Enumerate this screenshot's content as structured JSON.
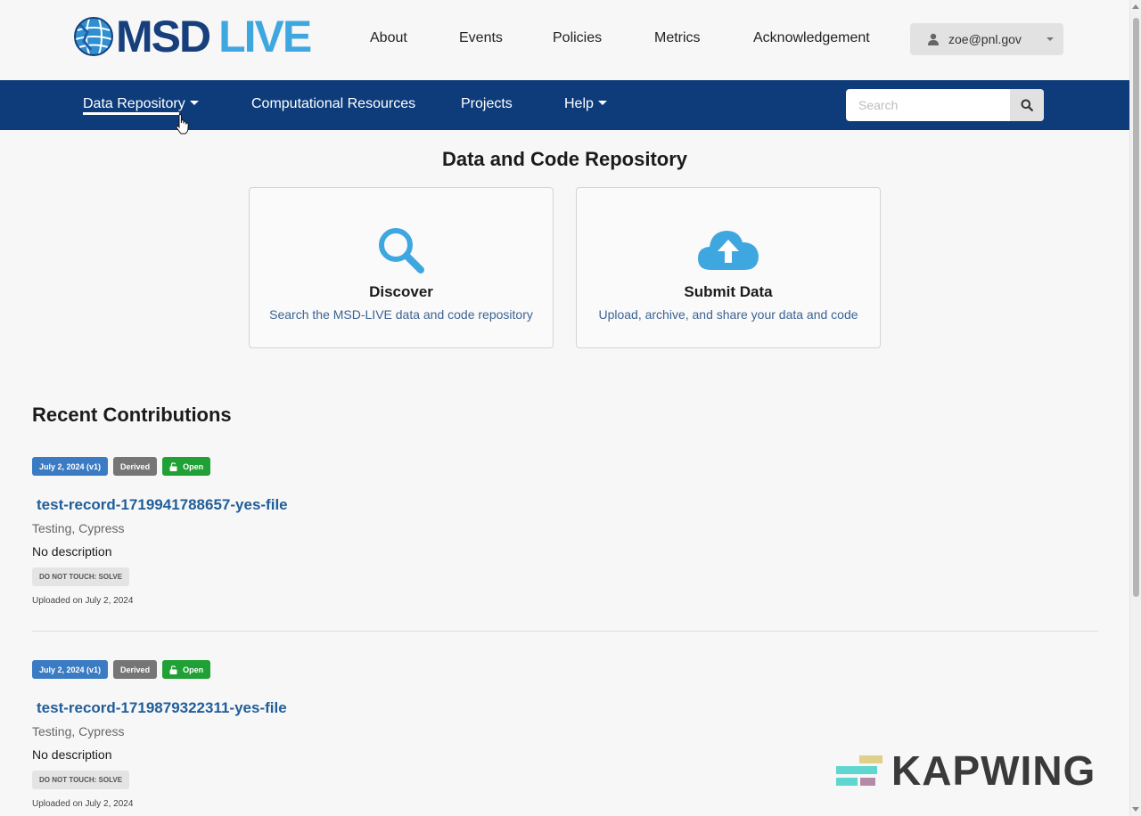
{
  "header": {
    "logo": {
      "msd": "MSD",
      "live": "LIVE"
    },
    "nav": [
      "About",
      "Events",
      "Policies",
      "Metrics",
      "Acknowledgement"
    ],
    "user": {
      "email": "zoe@pnl.gov"
    }
  },
  "main_nav": {
    "items": [
      "Data Repository",
      "Computational Resources",
      "Projects",
      "Help"
    ],
    "active": "Data Repository",
    "search": {
      "placeholder": "Search",
      "value": ""
    }
  },
  "page": {
    "title": "Data and Code Repository",
    "cards": [
      {
        "icon": "search-icon",
        "title": "Discover",
        "description": "Search the MSD-LIVE data and code repository"
      },
      {
        "icon": "cloud-upload-icon",
        "title": "Submit Data",
        "description": "Upload, archive, and share your data and code"
      }
    ]
  },
  "recent": {
    "title": "Recent Contributions",
    "records": [
      {
        "date_badge": "July 2, 2024 (v1)",
        "type_badge": "Derived",
        "access_badge": "Open",
        "title": "test-record-1719941788657-yes-file",
        "creators": "Testing, Cypress",
        "description": "No description",
        "keyword": "DO NOT TOUCH: SOLVE",
        "uploaded": "Uploaded on July 2, 2024"
      },
      {
        "date_badge": "July 2, 2024 (v1)",
        "type_badge": "Derived",
        "access_badge": "Open",
        "title": "test-record-1719879322311-yes-file",
        "creators": "Testing, Cypress",
        "description": "No description",
        "keyword": "DO NOT TOUCH: SOLVE",
        "uploaded": "Uploaded on July 2, 2024"
      }
    ]
  },
  "watermark": {
    "text": "KAPWING"
  },
  "colors": {
    "nav_bg": "#0e3c7a",
    "logo_dark": "#163f7c",
    "logo_light": "#3fa7e0",
    "link": "#215e9a",
    "badge_date": "#3b7bc4",
    "badge_type": "#767676",
    "badge_open": "#21a135"
  }
}
